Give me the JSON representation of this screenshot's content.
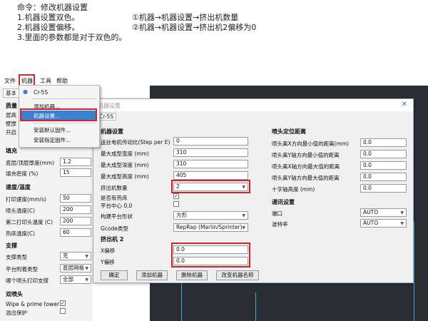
{
  "instructions": {
    "line1": "命令：修改机器设置",
    "line2a": "1.机器设置双色。",
    "line2b": "①机器→机器设置→挤出机数量",
    "line3a": "2.机器设置偏移。",
    "line3b": "②机器→机器设置→挤出机2偏移为0",
    "line4": "3.里面的参数都是对于双色的。"
  },
  "menubar": {
    "file": "文件",
    "machine": "机器",
    "tools": "工具",
    "help": "帮助"
  },
  "left_panel": {
    "tab_basic": "基本",
    "sections": {
      "quality": "质量",
      "fill": "填充",
      "speed_temp": "速度/温度",
      "support": "支撑",
      "dual": "双喷头"
    },
    "quality_labels": [
      "层高",
      "壁厚",
      "开启"
    ],
    "fill_rows": [
      {
        "label": "底层/顶层厚度(mm)",
        "value": "1.2"
      },
      {
        "label": "填充密度 (%)",
        "value": "15"
      }
    ],
    "speed_rows": [
      {
        "label": "打印速度(mm/s)",
        "value": "50"
      },
      {
        "label": "喷头温度(C)",
        "value": "200"
      },
      {
        "label": "第二打印头温度 (C)",
        "value": "200"
      },
      {
        "label": "热床温度(C)",
        "value": "60"
      }
    ],
    "support_rows": [
      {
        "label": "支撑类型",
        "value": "无"
      },
      {
        "label": "平台附着类型",
        "value": "底层网格"
      },
      {
        "label": "哪个喷头打印支撑",
        "value": "全部"
      }
    ],
    "dual_rows": [
      {
        "label": "Wipe & prime tower"
      },
      {
        "label": "溢出保护"
      }
    ]
  },
  "dropdown": {
    "selected_machine": "Cr-5S",
    "items": [
      "添加机器...",
      "机器设置...",
      "安装默认固件...",
      "安装指定固件..."
    ]
  },
  "dialog": {
    "title": "机器设置",
    "tab": "Cr-5S",
    "left_title": "机器设置",
    "rows": [
      {
        "label": "送丝电机传动比(Step per E)",
        "value": "0"
      },
      {
        "label": "最大成型宽度 (mm)",
        "value": "310"
      },
      {
        "label": "最大成型深度 (mm)",
        "value": "310"
      },
      {
        "label": "最大成型高度 (mm)",
        "value": "405"
      },
      {
        "label": "挤出机数量",
        "value": "2"
      },
      {
        "label": "是否有热床",
        "value": ""
      },
      {
        "label": "平台中心 0,0",
        "value": ""
      },
      {
        "label": "构建平台形状",
        "value": "方形"
      },
      {
        "label": "Gcode类型",
        "value": "RepRap (Marlin/Sprinter)"
      }
    ],
    "extruder2_title": "挤出机 2",
    "extruder2_rows": [
      {
        "label": "X偏移",
        "value": "0.0"
      },
      {
        "label": "Y偏移",
        "value": "0.0"
      }
    ],
    "right_title": "喷头定位距离",
    "right_rows": [
      {
        "label": "喷头离X方向最小值的距离(mm)",
        "value": "0.0"
      },
      {
        "label": "喷头离Y轴方向最小值的距离",
        "value": "0.0"
      },
      {
        "label": "喷头离X轴方向最大值的距离",
        "value": "0.0"
      },
      {
        "label": "喷头离Y轴方向最大值的距离",
        "value": "0.0"
      },
      {
        "label": "十字轴高度 (mm)",
        "value": "0.0"
      }
    ],
    "comm_title": "通讯设置",
    "comm_rows": [
      {
        "label": "端口",
        "value": "AUTO"
      },
      {
        "label": "波特率",
        "value": "AUTO"
      }
    ],
    "buttons": {
      "ok": "确定",
      "add": "添加机器",
      "remove": "删除机器",
      "rename": "改变机器名称"
    }
  },
  "colors": {
    "highlight": "#d2232a",
    "selected_item": "#3b7fd0",
    "viewport": "#2a2e33"
  }
}
